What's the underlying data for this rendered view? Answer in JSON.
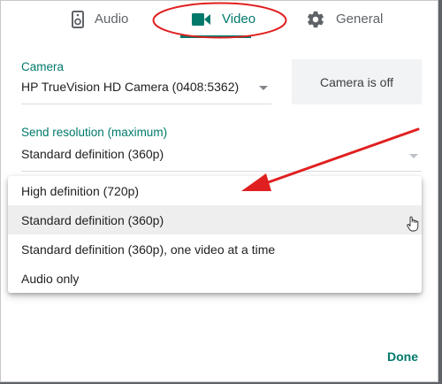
{
  "tabs": [
    {
      "label": "Audio",
      "icon": "speaker-icon",
      "active": false
    },
    {
      "label": "Video",
      "icon": "videocam-icon",
      "active": true
    },
    {
      "label": "General",
      "icon": "gear-icon",
      "active": false
    }
  ],
  "camera": {
    "label": "Camera",
    "selected": "HP TrueVision HD Camera (0408:5362)",
    "preview_text": "Camera is off"
  },
  "send_resolution": {
    "label": "Send resolution (maximum)",
    "selected": "Standard definition (360p)",
    "options": [
      "High definition (720p)",
      "Standard definition (360p)",
      "Standard definition (360p), one video at a time",
      "Audio only"
    ],
    "highlighted_index": 1
  },
  "footer": {
    "done_label": "Done"
  },
  "colors": {
    "accent": "#00796b",
    "annotation_red": "#e02020"
  }
}
